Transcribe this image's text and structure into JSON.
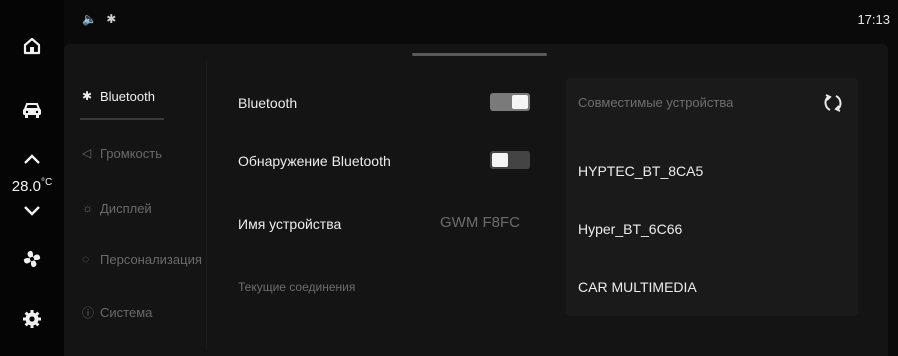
{
  "status_bar": {
    "icons_text": "🔈 ✱",
    "time": "17:13"
  },
  "climate": {
    "temperature": "28.0",
    "unit": "°C"
  },
  "menu": {
    "items": [
      {
        "label": "Bluetooth",
        "icon": "bluetooth-icon",
        "active": true
      },
      {
        "label": "Громкость",
        "icon": "volume-icon",
        "active": false
      },
      {
        "label": "Дисплей",
        "icon": "display-icon",
        "active": false
      },
      {
        "label": "Персонализация",
        "icon": "personalization-icon",
        "active": false
      },
      {
        "label": "Система",
        "icon": "system-icon",
        "active": false
      }
    ]
  },
  "settings": {
    "bluetooth_label": "Bluetooth",
    "bluetooth_enabled": true,
    "discovery_label": "Обнаружение Bluetooth",
    "discovery_enabled": false,
    "device_name_label": "Имя устройства",
    "device_name_value": "GWM F8FC",
    "current_connections_label": "Текущие соединения"
  },
  "devices": {
    "title": "Совместимые устройства",
    "items": [
      "HYPTEC_BT_8CA5",
      "Hyper_BT_6C66",
      "CAR MULTIMEDIA"
    ]
  }
}
